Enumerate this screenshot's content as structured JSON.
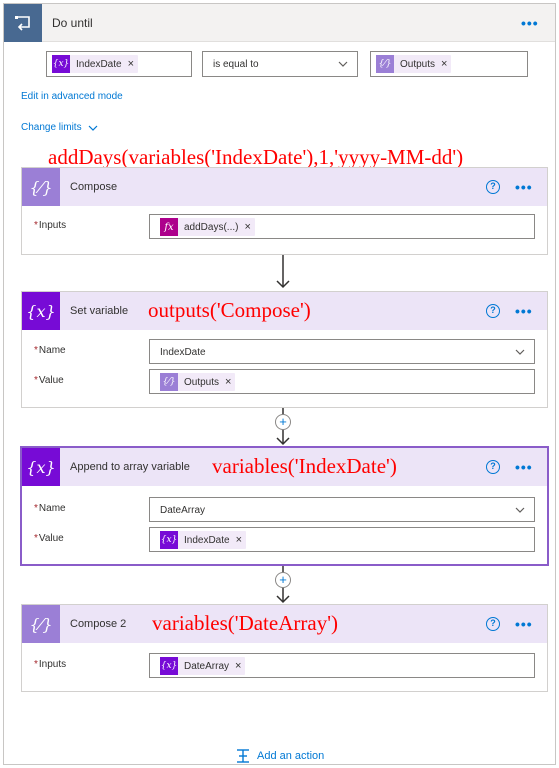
{
  "loop": {
    "title": "Do until",
    "condition": {
      "left_token": "IndexDate",
      "operator": "is equal to",
      "right_token": "Outputs"
    },
    "edit_link": "Edit in advanced mode",
    "limits_link": "Change limits"
  },
  "annotations": {
    "compose": "addDays(variables('IndexDate'),1,'yyyy-MM-dd')",
    "set_variable": "outputs('Compose')",
    "append": "variables('IndexDate')",
    "compose2": "variables('DateArray')"
  },
  "actions": [
    {
      "title": "Compose",
      "fields": [
        {
          "label": "Inputs",
          "token": "addDays(...)",
          "token_icon": "fx"
        }
      ]
    },
    {
      "title": "Set variable",
      "fields": [
        {
          "label": "Name",
          "value": "IndexDate"
        },
        {
          "label": "Value",
          "token": "Outputs",
          "token_icon": "{x}"
        }
      ]
    },
    {
      "title": "Append to array variable",
      "fields": [
        {
          "label": "Name",
          "value": "DateArray"
        },
        {
          "label": "Value",
          "token": "IndexDate",
          "token_icon": "{x}"
        }
      ]
    },
    {
      "title": "Compose 2",
      "fields": [
        {
          "label": "Inputs",
          "token": "DateArray",
          "token_icon": "{x}"
        }
      ]
    }
  ],
  "required_mark": "*",
  "add_action": "Add an action",
  "colors": {
    "loop_icon": "#486991",
    "variable_icon": "#770bd6",
    "compose_icon": "#9b7fd6",
    "header_bg": "#ece4f7",
    "expression_token": "#ad008c",
    "link": "#0078d4",
    "annotation": "#ff0000"
  }
}
